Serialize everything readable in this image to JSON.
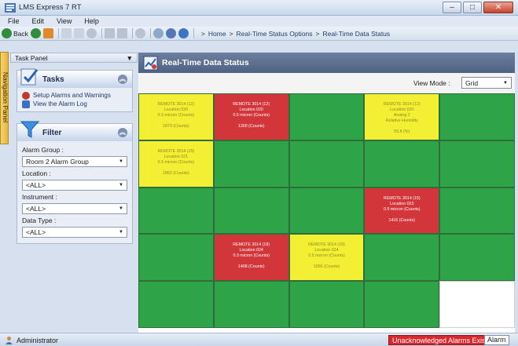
{
  "window": {
    "title": "LMS Express 7 RT"
  },
  "menu": [
    "File",
    "Edit",
    "View",
    "Help"
  ],
  "toolbar": {
    "back_label": "Back",
    "breadcrumb": [
      "Home",
      "Real-Time Status Options",
      "Real-Time Data Status"
    ]
  },
  "nav_panel_label": "Navigation Panel",
  "task_panel": {
    "title": "Task Panel",
    "pin_glyph": "▼",
    "tasks": {
      "title": "Tasks",
      "links": [
        "Setup Alarms and Warnings",
        "View the Alarm Log"
      ]
    },
    "filter": {
      "title": "Filter",
      "alarm_group_label": "Alarm Group :",
      "alarm_group_value": "Room 2 Alarm Group",
      "location_label": "Location :",
      "location_value": "<ALL>",
      "instrument_label": "Instrument :",
      "instrument_value": "<ALL>",
      "data_type_label": "Data Type :",
      "data_type_value": "<ALL>"
    }
  },
  "main": {
    "title": "Real-Time Data Status",
    "view_mode_label": "View Mode :",
    "view_mode_value": "Grid"
  },
  "grid_cells": [
    {
      "status": "yellow",
      "lines": [
        "REMOTE 3014 (12)",
        "Location 020",
        "0.3 micron (Counts)"
      ],
      "value": "1879 (Counts)"
    },
    {
      "status": "red",
      "lines": [
        "REMOTE 3014 (12)",
        "Location 020",
        "0.5 micron (Counts)"
      ],
      "value": "1300 (Counts)"
    },
    {
      "status": "green",
      "lines": [
        "",
        "",
        ""
      ],
      "value": ""
    },
    {
      "status": "yellow",
      "lines": [
        "REMOTE 3014 (12)",
        "Location 020",
        "Analog 2",
        "Relative Humidity"
      ],
      "value": "55.8 (%)"
    },
    {
      "status": "green",
      "lines": [
        "",
        "",
        ""
      ],
      "value": ""
    },
    {
      "status": "yellow",
      "lines": [
        "REMOTE 3014 (15)",
        "Location 021",
        "0.3 micron (Counts)"
      ],
      "value": "1862 (Counts)"
    },
    {
      "status": "green",
      "lines": [
        "",
        "",
        ""
      ],
      "value": ""
    },
    {
      "status": "green",
      "lines": [
        "",
        "",
        ""
      ],
      "value": ""
    },
    {
      "status": "green",
      "lines": [
        "",
        "",
        ""
      ],
      "value": ""
    },
    {
      "status": "green",
      "lines": [
        "",
        "",
        ""
      ],
      "value": ""
    },
    {
      "status": "green",
      "lines": [
        "",
        "",
        ""
      ],
      "value": ""
    },
    {
      "status": "green",
      "lines": [
        "",
        "",
        ""
      ],
      "value": ""
    },
    {
      "status": "green",
      "lines": [
        "",
        "",
        ""
      ],
      "value": ""
    },
    {
      "status": "red",
      "lines": [
        "REMOTE 3014 (15)",
        "Location 023",
        "0.5 micron (Counts)"
      ],
      "value": "1416 (Counts)"
    },
    {
      "status": "green",
      "lines": [
        "",
        "",
        ""
      ],
      "value": ""
    },
    {
      "status": "green",
      "lines": [
        "",
        "",
        ""
      ],
      "value": ""
    },
    {
      "status": "red",
      "lines": [
        "REMOTE 3014 (18)",
        "Location 024",
        "0.3 micron (Counts)"
      ],
      "value": "1408 (Counts)"
    },
    {
      "status": "yellow",
      "lines": [
        "REMOTE 3014 (18)",
        "Location 024",
        "0.5 micron (Counts)"
      ],
      "value": "1056 (Counts)"
    },
    {
      "status": "green",
      "lines": [
        "",
        "",
        ""
      ],
      "value": ""
    },
    {
      "status": "green",
      "lines": [
        "",
        "",
        ""
      ],
      "value": ""
    },
    {
      "status": "green",
      "lines": [
        "",
        "",
        ""
      ],
      "value": ""
    },
    {
      "status": "green",
      "lines": [
        "",
        "",
        ""
      ],
      "value": ""
    },
    {
      "status": "green",
      "lines": [
        "",
        "",
        ""
      ],
      "value": ""
    },
    {
      "status": "green",
      "lines": [
        "",
        "",
        ""
      ],
      "value": ""
    },
    {
      "status": "white",
      "lines": [],
      "value": ""
    }
  ],
  "status_bar": {
    "user": "Administrator",
    "alarm_notice": "Unacknowledged Alarms Exist",
    "alarm_button": "Alarm"
  },
  "colors": {
    "ok": "#2fa347",
    "alarm": "#d2353a",
    "warning": "#f3ef33",
    "header": "#5a6e8e"
  }
}
